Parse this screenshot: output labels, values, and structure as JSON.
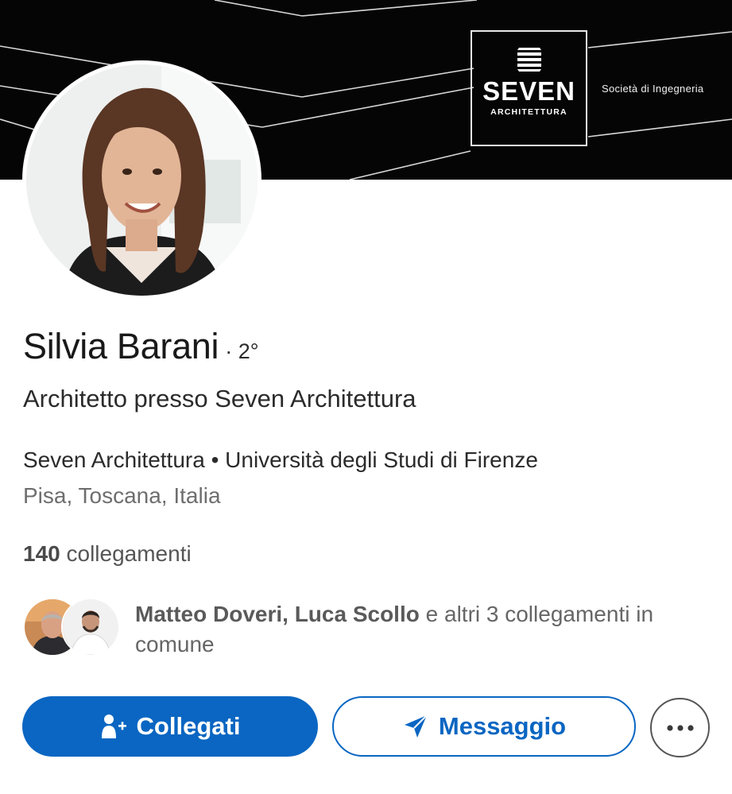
{
  "banner": {
    "logo_name": "SEVEN",
    "logo_subtitle": "ARCHITETTURA",
    "tagline": "Società di Ingegneria"
  },
  "profile": {
    "name": "Silvia Barani",
    "degree": "· 2°",
    "headline": "Architetto presso Seven Architettura",
    "organizations": "Seven Architettura • Università degli Studi di Firenze",
    "location": "Pisa, Toscana, Italia",
    "connections_count": "140",
    "connections_label": " collegamenti"
  },
  "mutual": {
    "names": "Matteo Doveri, Luca Scollo",
    "rest": " e altri 3 collegamenti in comune"
  },
  "actions": {
    "connect_label": "Collegati",
    "message_label": "Messaggio",
    "more_icon": "more-horizontal-icon"
  },
  "colors": {
    "brand_blue": "#0a66c2",
    "banner_bg": "#050505"
  }
}
